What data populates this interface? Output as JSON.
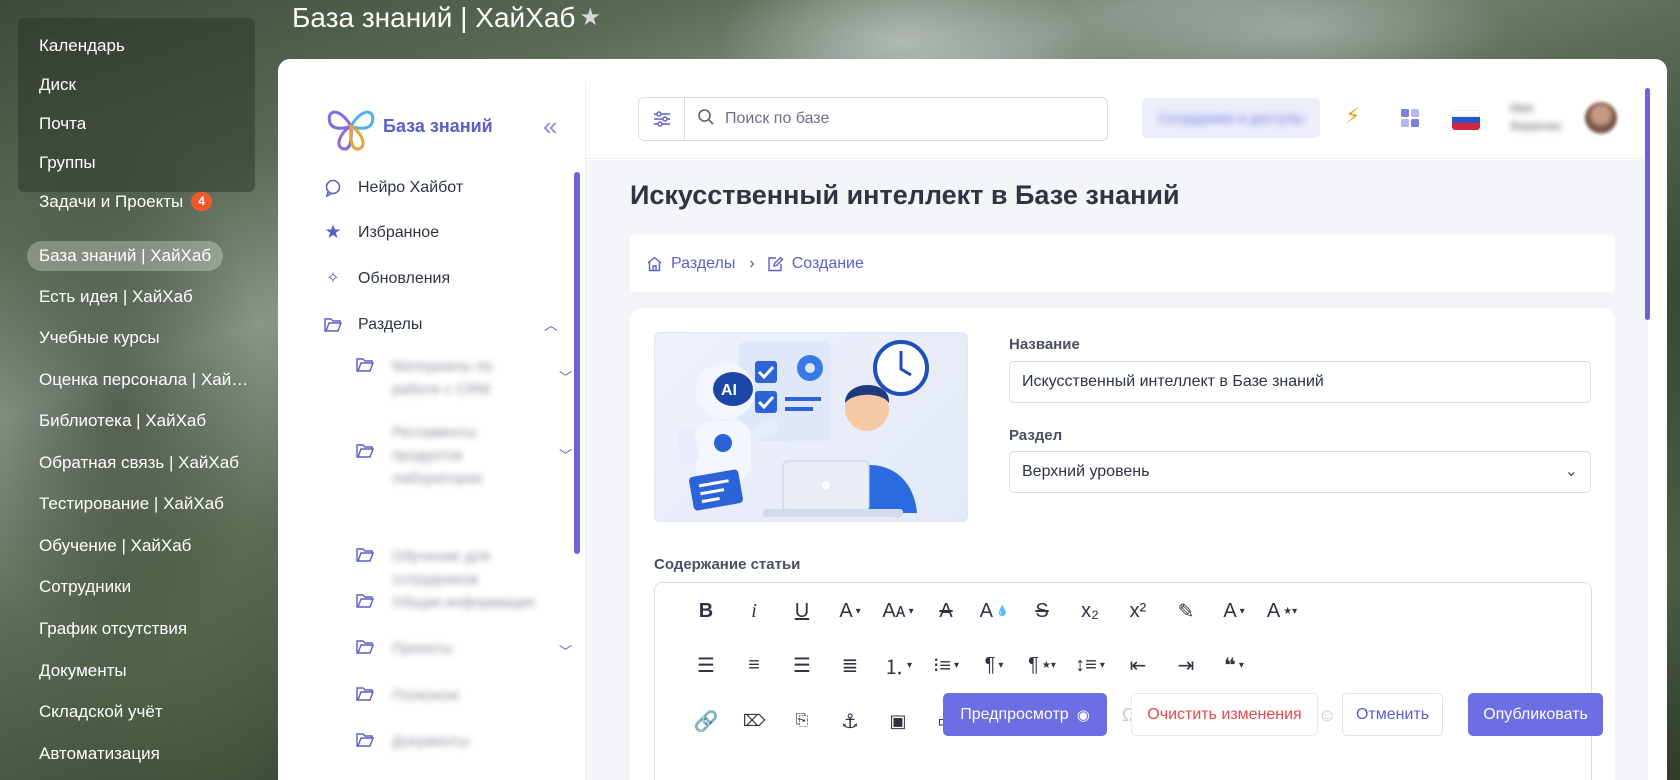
{
  "page": {
    "header_title": "База знаний | ХайХаб"
  },
  "portal_menu": {
    "items": [
      {
        "label": "Календарь"
      },
      {
        "label": "Диск"
      },
      {
        "label": "Почта"
      },
      {
        "label": "Группы"
      },
      {
        "label": "Задачи и Проекты",
        "badge": "4"
      },
      {
        "label": "База знаний | ХайХаб",
        "active": true
      },
      {
        "label": "Есть идея | ХайХаб"
      },
      {
        "label": "Учебные курсы"
      },
      {
        "label": "Оценка персонала | ХайХаб"
      },
      {
        "label": "Библиотека | ХайХаб"
      },
      {
        "label": "Обратная связь | ХайХаб"
      },
      {
        "label": "Тестирование | ХайХаб"
      },
      {
        "label": "Обучение | ХайХаб"
      },
      {
        "label": "Сотрудники"
      },
      {
        "label": "График отсутствия"
      },
      {
        "label": "Документы"
      },
      {
        "label": "Складской учёт"
      },
      {
        "label": "Автоматизация"
      }
    ],
    "badge_color": "#f05a28"
  },
  "kb_sidebar": {
    "brand": "База знаний",
    "nav": [
      {
        "label": "Нейро Хайбот",
        "icon": "chat-bot-icon"
      },
      {
        "label": "Избранное",
        "icon": "star-icon"
      },
      {
        "label": "Обновления",
        "icon": "sparkle-icon"
      },
      {
        "label": "Разделы",
        "icon": "folder-open-icon",
        "expanded": true
      }
    ],
    "sections": [
      {
        "label": "Материалы по работе с CRM",
        "has_children": true
      },
      {
        "label": "Регламенты продуктов лаборатории",
        "has_children": true
      },
      {
        "label": "Обучение для сотрудников",
        "has_children": false
      },
      {
        "label": "Общая информация",
        "has_children": false
      },
      {
        "label": "Проекты",
        "has_children": true
      },
      {
        "label": "Полезное",
        "has_children": false
      },
      {
        "label": "Документы",
        "has_children": false
      }
    ]
  },
  "topbar": {
    "search_placeholder": "Поиск по базе",
    "blurred_button": "Сотрудники и доступы",
    "user_name": "Имя Фамилия",
    "accent_color": "#6c63d8"
  },
  "article": {
    "title": "Искусственный интеллект в Базе знаний",
    "breadcrumb": [
      {
        "label": "Разделы",
        "icon": "home-icon"
      },
      {
        "label": "Создание",
        "icon": "edit-icon"
      }
    ],
    "cover_ai_label": "AI",
    "name_label": "Название",
    "name_value": "Искусственный интеллект в Базе знаний",
    "section_label": "Раздел",
    "section_value": "Верхний уровень",
    "content_label": "Содержание статьи"
  },
  "actions": {
    "preview": "Предпросмотр",
    "clear": "Очистить изменения",
    "cancel": "Отменить",
    "publish": "Опубликовать"
  }
}
